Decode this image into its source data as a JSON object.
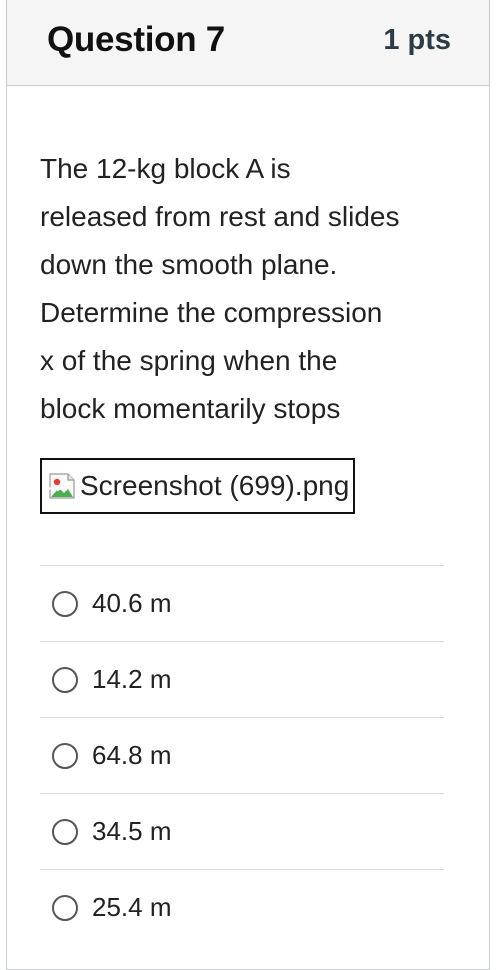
{
  "question": {
    "title": "Question 7",
    "points": "1 pts",
    "text_lines": [
      " The 12-kg block A is",
      "released from rest and slides",
      "down the smooth plane.",
      "Determine the compression",
      "x of the spring when the",
      "block momentarily stops"
    ],
    "attachment": {
      "name": "Screenshot (699).png",
      "icon": "broken-image-icon"
    }
  },
  "answers": [
    {
      "label": "40.6 m",
      "selected": false
    },
    {
      "label": "14.2 m",
      "selected": false
    },
    {
      "label": "64.8 m",
      "selected": false
    },
    {
      "label": "34.5 m",
      "selected": false
    },
    {
      "label": "25.4 m",
      "selected": false
    }
  ]
}
